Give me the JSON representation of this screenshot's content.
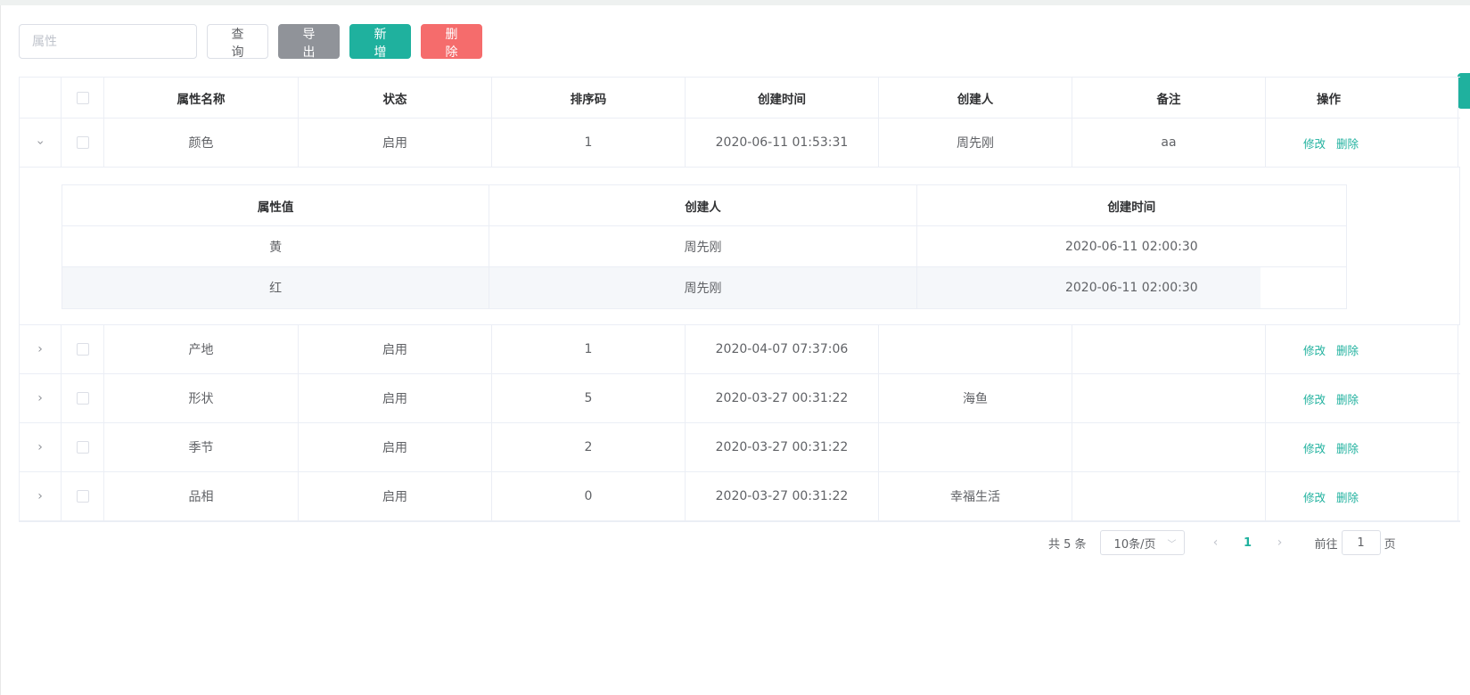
{
  "toolbar": {
    "search_placeholder": "属性",
    "query_label": "查询",
    "export_label": "导出",
    "add_label": "新增",
    "delete_label": "删除"
  },
  "table": {
    "headers": {
      "name": "属性名称",
      "status": "状态",
      "sort": "排序码",
      "created_time": "创建时间",
      "creator": "创建人",
      "remark": "备注",
      "ops": "操作"
    },
    "rows": [
      {
        "name": "颜色",
        "status": "启用",
        "sort": "1",
        "created_time": "2020-06-11 01:53:31",
        "creator": "周先刚",
        "remark": "aa",
        "edit": "修改",
        "delete": "删除",
        "expanded": true
      },
      {
        "name": "产地",
        "status": "启用",
        "sort": "1",
        "created_time": "2020-04-07 07:37:06",
        "creator": "",
        "remark": "",
        "edit": "修改",
        "delete": "删除"
      },
      {
        "name": "形状",
        "status": "启用",
        "sort": "5",
        "created_time": "2020-03-27 00:31:22",
        "creator": "海鱼",
        "remark": "",
        "edit": "修改",
        "delete": "删除"
      },
      {
        "name": "季节",
        "status": "启用",
        "sort": "2",
        "created_time": "2020-03-27 00:31:22",
        "creator": "",
        "remark": "",
        "edit": "修改",
        "delete": "删除"
      },
      {
        "name": "品相",
        "status": "启用",
        "sort": "0",
        "created_time": "2020-03-27 00:31:22",
        "creator": "幸福生活",
        "remark": "",
        "edit": "修改",
        "delete": "删除"
      }
    ]
  },
  "subtable": {
    "headers": {
      "value": "属性值",
      "creator": "创建人",
      "created_time": "创建时间"
    },
    "rows": [
      {
        "value": "黄",
        "creator": "周先刚",
        "created_time": "2020-06-11 02:00:30"
      },
      {
        "value": "红",
        "creator": "周先刚",
        "created_time": "2020-06-11 02:00:30"
      }
    ]
  },
  "pagination": {
    "total": "共 5 条",
    "page_size": "10条/页",
    "current": "1",
    "goto_prefix": "前往",
    "goto_value": "1",
    "goto_suffix": "页"
  },
  "colors": {
    "primary": "#1fb19e",
    "danger": "#f56c6c",
    "info": "#909399"
  }
}
